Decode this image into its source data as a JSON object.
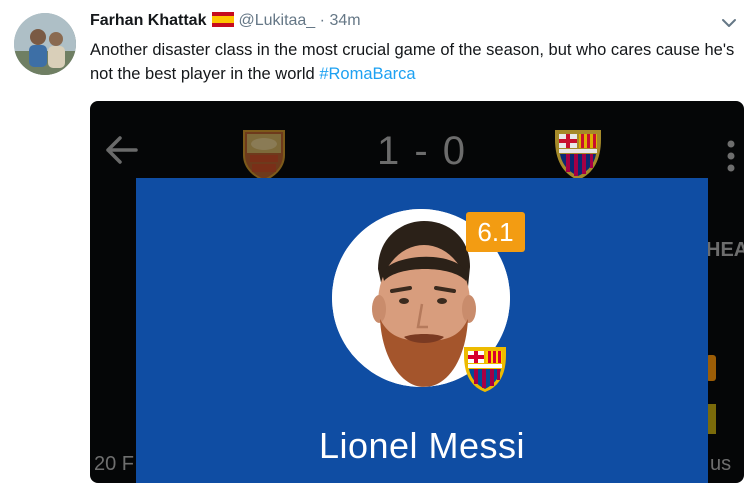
{
  "tweet": {
    "author_name": "Farhan Khattak",
    "flag_icon": "spain-flag-icon",
    "handle": "@Lukitaa_",
    "separator": "·",
    "time": "34m",
    "text": "Another disaster class in the most crucial game of the season, but who cares cause he's not the best player in the world ",
    "hashtag": "#RomaBarca"
  },
  "media": {
    "score": "1 - 0",
    "home_crest_icon": "as-roma-crest-icon",
    "away_crest_icon": "fc-barcelona-crest-icon",
    "background_labels": {
      "hea": "HEA",
      "left_bottom": "20 F",
      "right_bottom": "us"
    },
    "player_card": {
      "rating": "6.1",
      "name": "Lionel Messi",
      "background_color": "#0f4da3",
      "rating_color": "#f39c12"
    }
  },
  "colors": {
    "hashtag": "#1da1f2",
    "secondary_text": "#657786"
  }
}
